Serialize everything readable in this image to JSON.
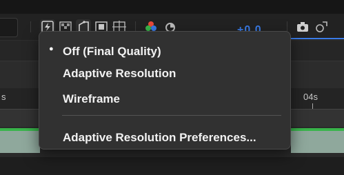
{
  "toolbar": {
    "exposure_value": "+0.0",
    "icons": [
      "fast-preview-icon",
      "transparency-grid-icon",
      "mask-outline-icon",
      "region-of-interest-icon",
      "safe-margins-icon",
      "channel-color-icon",
      "exposure-reset-icon",
      "snapshot-icon",
      "show-snapshot-icon"
    ]
  },
  "ruler": {
    "left_label": "s",
    "right_label": "04s"
  },
  "menu": {
    "items": [
      {
        "label": "Off (Final Quality)",
        "checked": true
      },
      {
        "label": "Adaptive Resolution",
        "checked": false
      },
      {
        "label": "Wireframe",
        "checked": false
      }
    ],
    "preferences_label": "Adaptive Resolution Preferences...",
    "check_glyph": "●"
  },
  "colors": {
    "accent_blue": "#3a7ce8",
    "track_green": "#38b44a",
    "menu_bg": "#313131"
  }
}
